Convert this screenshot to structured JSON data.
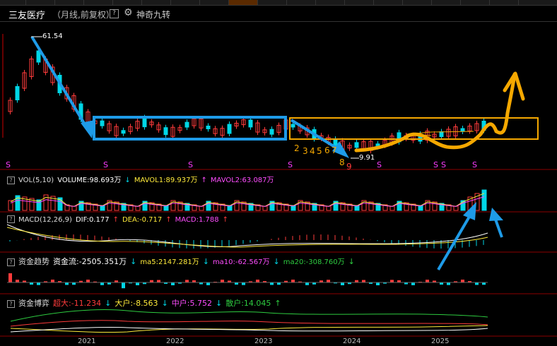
{
  "header": {
    "title": "三友医疗",
    "subtitle": "（月线,前复权）",
    "help": "?",
    "tool": "神奇九转"
  },
  "main_chart": {
    "high_marker": "61.54",
    "low_marker": "9.91",
    "countdown": [
      "2",
      "3",
      "4",
      "5",
      "6",
      "7",
      "8",
      "9"
    ],
    "signal_char": "S"
  },
  "volume": {
    "label": "VOL(5,10)",
    "volume": "VOLUME:98.693万",
    "mavol1": "MAVOL1:89.937万",
    "mavol1_arrow": "↓",
    "mavol2": "MAVOL2:63.087万",
    "mavol2_arrow": "↑"
  },
  "macd": {
    "label": "MACD(12,26,9)",
    "dif": "DIF:0.177",
    "dif_arrow": "↑",
    "dea": "DEA:-0.717",
    "dea_arrow": "↑",
    "macd": "MACD:1.788",
    "macd_arrow": "↑"
  },
  "fund_trend": {
    "label": "资金趋势",
    "flow": "资金流:-2505.351万",
    "flow_arrow": "↓",
    "ma5": "ma5:2147.281万",
    "ma5_arrow": "↓",
    "ma10": "ma10:-62.567万",
    "ma10_arrow": "↓",
    "ma20": "ma20:-308.760万",
    "ma20_arrow": "↓"
  },
  "fund_game": {
    "label": "资金博弈",
    "super": "超大:-11.234",
    "super_arrow": "↓",
    "big": "大户:-8.563",
    "big_arrow": "↓",
    "mid": "中户:5.752",
    "mid_arrow": "↓",
    "retail": "散户:14.045",
    "retail_arrow": "↑"
  },
  "x_axis": [
    "2021",
    "2022",
    "2023",
    "2024",
    "2025"
  ],
  "colors": {
    "up": "#ff3b3b",
    "down": "#00d6e6",
    "annotation_blue": "#1e9be8",
    "annotation_orange": "#f5a800",
    "mavol1": "#ffeb3b",
    "mavol2": "#ff4dff"
  }
}
